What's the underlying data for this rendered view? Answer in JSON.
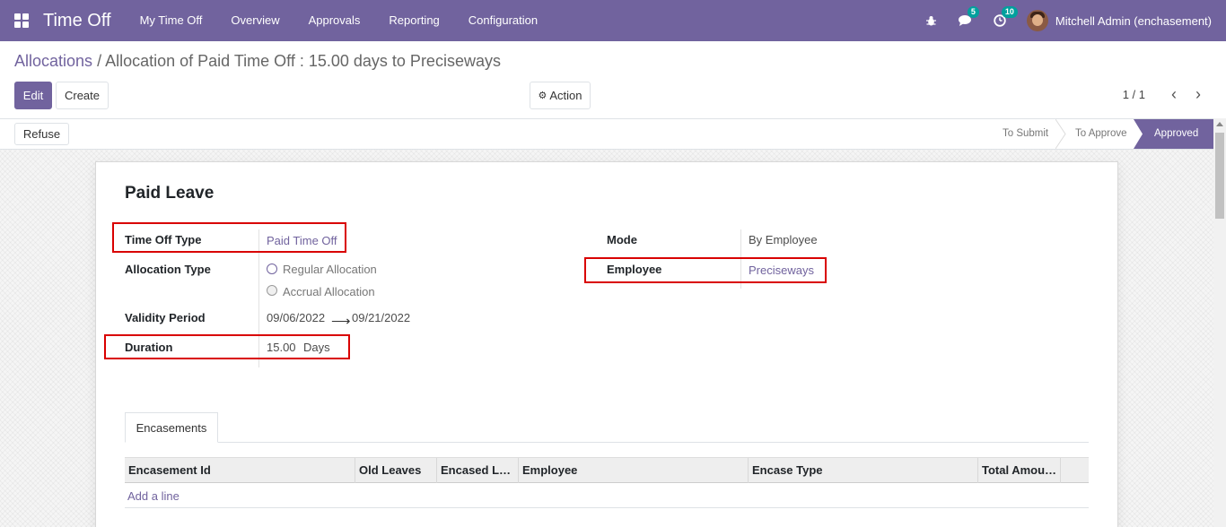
{
  "navbar": {
    "app_title": "Time Off",
    "menu": [
      "My Time Off",
      "Overview",
      "Approvals",
      "Reporting",
      "Configuration"
    ],
    "messages_count": "5",
    "activities_count": "10",
    "user": "Mitchell Admin (enchasement)",
    "icons": [
      "apps-icon",
      "bug-icon",
      "chat-icon",
      "clock-icon"
    ]
  },
  "breadcrumb": {
    "parent": "Allocations",
    "current": "Allocation of Paid Time Off : 15.00 days to Preciseways"
  },
  "buttons": {
    "edit": "Edit",
    "create": "Create",
    "action": "Action",
    "refuse": "Refuse"
  },
  "pager": "1 / 1",
  "status": {
    "stages": [
      "To Submit",
      "To Approve",
      "Approved"
    ],
    "active": "Approved"
  },
  "form": {
    "title": "Paid Leave",
    "time_off_type_label": "Time Off Type",
    "time_off_type": "Paid Time Off",
    "allocation_type_label": "Allocation Type",
    "allocation_options": [
      "Regular Allocation",
      "Accrual Allocation"
    ],
    "validity_label": "Validity Period",
    "validity_from": "09/06/2022",
    "validity_to": "09/21/2022",
    "duration_label": "Duration",
    "duration_value": "15.00",
    "duration_unit": "Days",
    "mode_label": "Mode",
    "mode": "By Employee",
    "employee_label": "Employee",
    "employee": "Preciseways"
  },
  "notebook": {
    "tab": "Encasements",
    "columns": [
      "Encasement Id",
      "Old Leaves",
      "Encased L…",
      "Employee",
      "Encase Type",
      "Total Amou…"
    ],
    "add_line": "Add a line"
  },
  "colors": {
    "brand": "#71639e",
    "highlight": "#d90000",
    "badge": "#00a09d"
  }
}
